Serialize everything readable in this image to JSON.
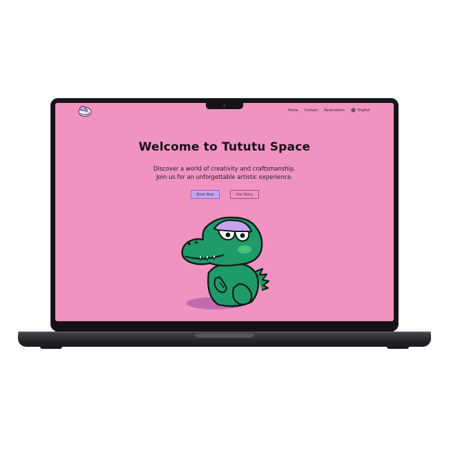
{
  "site": {
    "nav": {
      "home": "Home",
      "contact": "Contact",
      "reservation": "Reservation",
      "language": "English"
    },
    "hero": {
      "title": "Welcome to Tututu Space",
      "subtitle_line1": "Discover a world of creativity and craftsmanship.",
      "subtitle_line2": "Join us for an unforgettable artistic experience.",
      "primary_button": "Book Now",
      "secondary_button": "Our Story"
    },
    "icons": {
      "logo": "logo-icon",
      "language": "globe-icon",
      "mascot": "crocodile-mascot"
    }
  },
  "colors": {
    "page_background": "#f193c1",
    "primary_button": "#c6a3ea",
    "primary_button_border": "#8b63c8",
    "secondary_button_border": "#a24a7c",
    "mascot_green": "#1f9a69",
    "laptop_frame": "#141416"
  }
}
